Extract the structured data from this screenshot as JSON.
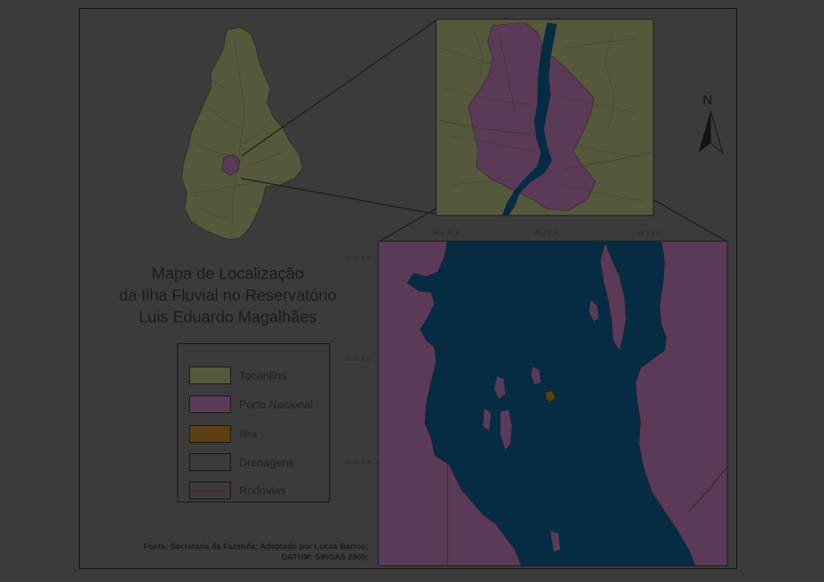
{
  "title": {
    "line1": "Mapa de Localização",
    "line2": "da Ilha Fluvial no Reservatório",
    "line3": "Luis Eduardo Magalhães"
  },
  "legend": {
    "items": [
      {
        "label": "Tocantins",
        "color": "#55583b",
        "kind": "fill"
      },
      {
        "label": "Porto Nacional",
        "color": "#5a3a56",
        "kind": "fill"
      },
      {
        "label": "Ilha",
        "color": "#5c3e13",
        "kind": "fill"
      },
      {
        "label": "Drenagens",
        "color": "#2e3b49",
        "kind": "line"
      },
      {
        "label": "Rodovias",
        "color": "#5a2020",
        "kind": "line"
      }
    ]
  },
  "north_arrow": {
    "label": "N"
  },
  "source": {
    "line1": "Fonte: Secretaria da Fazenda; Adaptado por Lucas Barros;",
    "line2": "DATUM: SIRGAS 2000;"
  },
  "grid_labels": {
    "top": [
      "48.4.15.0",
      "48.4.5.0",
      "48.3.5.0"
    ],
    "left": [
      "10.41.0.0",
      "10.42.5.0",
      "10.43.5.0"
    ]
  },
  "colors": {
    "water": "#052c42",
    "porto_nacional": "#5a3a56",
    "tocantins": "#55583b",
    "ilha": "#5c3e13",
    "background": "#3b3b3b"
  }
}
